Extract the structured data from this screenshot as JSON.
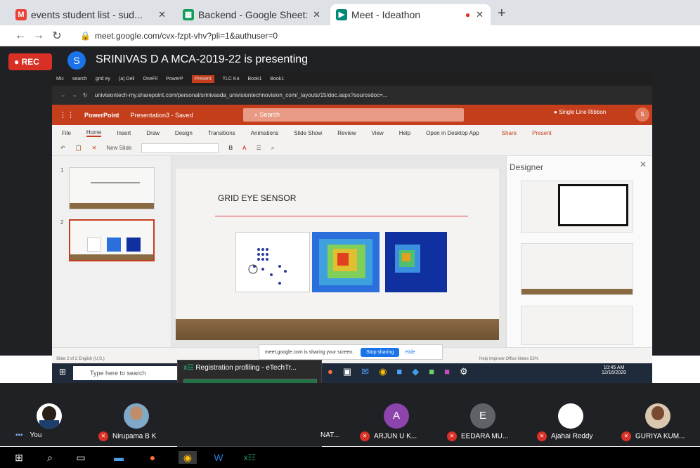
{
  "browser": {
    "tabs": [
      {
        "title": "events student list - sud...",
        "icon": "gmail-icon",
        "color": "#ea4335"
      },
      {
        "title": "Backend - Google Sheet:",
        "icon": "sheets-icon",
        "color": "#0f9d58"
      },
      {
        "title": "Meet - Ideathon",
        "icon": "meet-icon",
        "color": "#00897b",
        "active": true
      }
    ],
    "url": "meet.google.com/cvx-fzpt-vhv?pli=1&authuser=0"
  },
  "meet": {
    "rec_label": "REC",
    "presenter_initial": "S",
    "presenter_text": "SRINIVAS D A MCA-2019-22 is presenting"
  },
  "shared": {
    "inner_tabs": [
      "Mic",
      "search",
      "grid ey",
      "(a) Deli",
      "OneFil",
      "PowerP",
      "Present",
      "TLC Ko",
      "Book1",
      "Book1"
    ],
    "inner_url": "univisiontech-my.sharepoint.com/personal/srinivasda_univisiontechnovision_com/_layouts/15/doc.aspx?sourcedoc=...",
    "app_name": "PowerPoint",
    "doc_title": "Presentation3 - Saved",
    "search_placeholder": "Search",
    "ribbon_toggle": "Single Line Ribbon",
    "user_initial": "S",
    "menu": [
      "File",
      "Home",
      "Insert",
      "Draw",
      "Design",
      "Transitions",
      "Animations",
      "Slide Show",
      "Review",
      "View",
      "Help",
      "Open in Desktop App"
    ],
    "share_label": "Share",
    "present_label": "Present",
    "new_slide_label": "New Slide",
    "slide_title": "GRID EYE SENSOR",
    "designer_title": "Designer",
    "status": "Slide 2 of 2   English (U.S.)",
    "status_right": "Help Improve Office   Notes   53%",
    "share_banner_text": "meet.google.com is sharing your screen.",
    "stop_label": "Stop sharing",
    "hide_label": "Hide",
    "taskbar_search": "Type here to search",
    "clock_time": "10:45 AM",
    "clock_date": "12/16/2020",
    "excel_title": "Registration profiling - eTechTr...",
    "thumb_numbers": [
      "1",
      "2"
    ]
  },
  "participants": [
    {
      "name": "You",
      "initial": "",
      "color": "#3c4043"
    },
    {
      "name": "Nirupama B K",
      "initial": "",
      "color": "#3c4043"
    },
    {
      "name": "NAT...",
      "initial": "",
      "color": "#3c4043"
    },
    {
      "name": "ARJUN U K...",
      "initial": "A",
      "color": "#8e44ad"
    },
    {
      "name": "EEDARA MU...",
      "initial": "E",
      "color": "#5f6368"
    },
    {
      "name": "Ajahai Reddy",
      "initial": "",
      "color": "#ffffff"
    },
    {
      "name": "GURIYA KUM...",
      "initial": "",
      "color": "#3c4043"
    }
  ]
}
